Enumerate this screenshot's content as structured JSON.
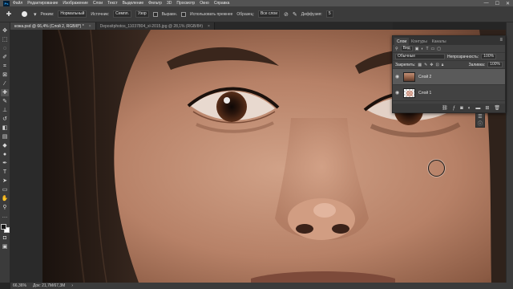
{
  "menubar": {
    "logo": "Ps",
    "items": [
      "Файл",
      "Редактирование",
      "Изображение",
      "Слои",
      "Текст",
      "Выделение",
      "Фильтр",
      "3D",
      "Просмотр",
      "Окно",
      "Справка"
    ],
    "minimize": "—",
    "maximize": "☐",
    "close": "✕"
  },
  "options": {
    "mode_label": "Режим:",
    "mode_value": "Нормальный",
    "source_label": "Источник:",
    "source_sample": "Семпл.",
    "source_pattern": "Узор",
    "aligned_label": "Выравн.",
    "use_legacy_label": "Использовать прежнее",
    "sample_label": "Образец:",
    "sample_value": "Все слои",
    "diffusion_label": "Диффузия:",
    "diffusion_value": "5"
  },
  "tabs": [
    {
      "label": "кожа.psd @ 66,4% (Слой 2, RGB/8*) *",
      "close": "×"
    },
    {
      "label": "Depositphotos_11037804_xl-2015.jpg @ 28,1% (RGB/8#)",
      "close": "×"
    }
  ],
  "layers_panel": {
    "tabs": [
      "Слои",
      "Контуры",
      "Каналы"
    ],
    "menu_icon": "≡",
    "filter_kind": "Вид",
    "blend_mode": "Обычные",
    "opacity_label": "Непрозрачность:",
    "opacity_value": "100%",
    "lock_label": "Закрепить:",
    "fill_label": "Заливка:",
    "fill_value": "100%",
    "layers": [
      {
        "name": "Слой 2",
        "selected": true
      },
      {
        "name": "Слой 1",
        "selected": false
      }
    ]
  },
  "statusbar": {
    "zoom": "66,36%",
    "doc_size": "Док: 21,7М/67,3М"
  }
}
